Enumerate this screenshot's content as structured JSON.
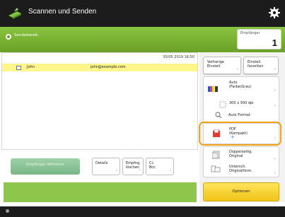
{
  "header": {
    "title": "Scannen und Senden",
    "app_icon": "scanner-arrow-icon",
    "settings_icon": "gear-icon"
  },
  "status": {
    "text": "Sendebereit.",
    "recipients_label": "Empfänger",
    "recipients_count": "1",
    "status_color": "#6aa126"
  },
  "recipients": {
    "date": "30/05 2019 16:50",
    "rows": [
      {
        "name": "John",
        "email": "john@example.com"
      }
    ]
  },
  "side_buttons": {
    "previous_settings": "Vorherige Einstell.",
    "favorites": "Einstell. favoriten"
  },
  "settings": [
    {
      "label": "Auto (Farbe/Grau)",
      "icon": "color-mode-icon"
    },
    {
      "label": "300 x 300 dpi",
      "icon": "resolution-icon"
    },
    {
      "label": "Auto Format",
      "icon": "scan-size-icon"
    },
    {
      "label": "PDF (Kompakt)",
      "icon": "pdf-file-icon",
      "highlighted": true
    },
    {
      "label": "Doppelseitig. Original",
      "icon": "duplex-original-icon"
    },
    {
      "label": "Untersch. Originalform.",
      "icon": "mixed-originals-icon"
    }
  ],
  "bottom": {
    "send_button": "Empfänger definieren",
    "details": "Details",
    "recipients_list": "Empfng. löschen",
    "cc_bcc": "Cc Bcc",
    "options": "Optionen"
  },
  "colors": {
    "accent_green": "#8ec64c",
    "options_yellow": "#f0c419",
    "highlight_orange": "#f4a315",
    "row_yellow": "#fff68a"
  }
}
